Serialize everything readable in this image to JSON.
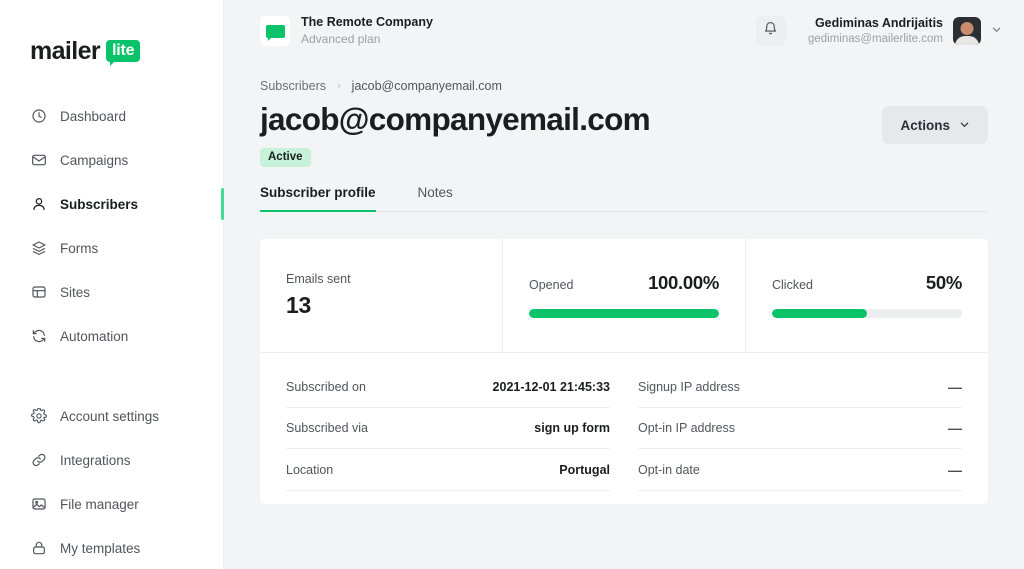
{
  "brand": {
    "logo_word": "mailer",
    "logo_badge": "lite",
    "accent_green": "#09c269",
    "accent_green_light": "#3ddc91",
    "badge_green_bg": "#c5f2d9"
  },
  "sidebar": {
    "primary_items": [
      {
        "label": "Dashboard",
        "icon": "clock-icon",
        "active": false
      },
      {
        "label": "Campaigns",
        "icon": "envelope-icon",
        "active": false
      },
      {
        "label": "Subscribers",
        "icon": "user-icon",
        "active": true
      },
      {
        "label": "Forms",
        "icon": "layers-icon",
        "active": false
      },
      {
        "label": "Sites",
        "icon": "browser-window-icon",
        "active": false
      },
      {
        "label": "Automation",
        "icon": "refresh-cycle-icon",
        "active": false
      }
    ],
    "secondary_items": [
      {
        "label": "Account settings",
        "icon": "gear-icon"
      },
      {
        "label": "Integrations",
        "icon": "link-icon"
      },
      {
        "label": "File manager",
        "icon": "image-icon"
      },
      {
        "label": "My templates",
        "icon": "lock-icon"
      }
    ]
  },
  "topbar": {
    "company_name": "The Remote Company",
    "company_plan": "Advanced plan",
    "company_icon": "speech-bubble-icon",
    "notification_icon": "bell-icon",
    "user_name": "Gediminas Andrijaitis",
    "user_email": "gediminas@mailerlite.com",
    "avatar_icon": "avatar",
    "chevron_icon": "chevron-down-icon"
  },
  "breadcrumb": {
    "parent": "Subscribers",
    "separator": "›",
    "current": "jacob@companyemail.com"
  },
  "page": {
    "title": "jacob@companyemail.com",
    "status": "Active",
    "actions_label": "Actions"
  },
  "tabs": [
    {
      "label": "Subscriber profile",
      "active": true
    },
    {
      "label": "Notes",
      "active": false
    }
  ],
  "stats": {
    "emails_sent": {
      "label": "Emails sent",
      "value": "13"
    },
    "opened": {
      "label": "Opened",
      "value": "100.00%",
      "percent": 100
    },
    "clicked": {
      "label": "Clicked",
      "value": "50%",
      "percent": 50
    }
  },
  "details_left": [
    {
      "key": "Subscribed on",
      "value": "2021-12-01 21:45:33"
    },
    {
      "key": "Subscribed via",
      "value": "sign up form"
    },
    {
      "key": "Location",
      "value": "Portugal"
    }
  ],
  "details_right": [
    {
      "key": "Signup IP address",
      "value": "—"
    },
    {
      "key": "Opt-in IP address",
      "value": "—"
    },
    {
      "key": "Opt-in date",
      "value": "—"
    }
  ]
}
